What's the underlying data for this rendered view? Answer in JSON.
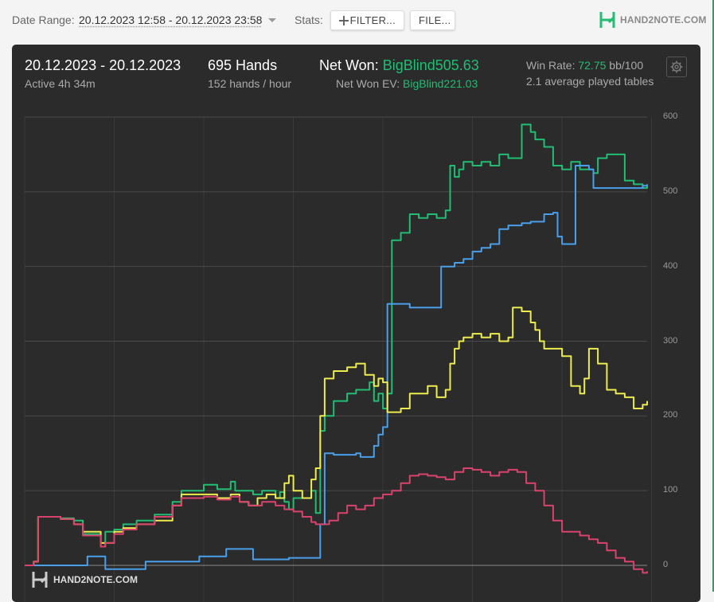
{
  "topbar": {
    "date_range_label": "Date Range:",
    "date_range_value": "20.12.2023 12:58 - 20.12.2023 23:58",
    "stats_label": "Stats:",
    "filter_button": "FILTER...",
    "file_button": "FILE...",
    "brand": "HAND2NOTE.COM"
  },
  "summary": {
    "dates": "20.12.2023 - 20.12.2023",
    "active": "Active 4h 34m",
    "hands": "695 Hands",
    "hands_per_hour": "152 hands / hour",
    "net_won_label": "Net Won:",
    "net_won_value": "BigBlind505.63",
    "net_won_ev_label": "Net Won  EV:",
    "net_won_ev_value": "BigBlind221.03",
    "win_rate_label": "Win Rate:",
    "win_rate_value": "72.75",
    "win_rate_unit": "bb/100",
    "avg_tables": "2.1 average played tables"
  },
  "watermark": "HAND2NOTE.COM",
  "colors": {
    "green": "#21bd73",
    "blue": "#4a9fea",
    "yellow": "#ecec4e",
    "red": "#d9426c",
    "panel": "#2b2b2b"
  },
  "icons": [
    "gear-icon",
    "plus-icon",
    "hand2note-logo-icon"
  ],
  "chart_data": {
    "type": "line",
    "title": "",
    "xlabel": "",
    "ylabel": "",
    "xlim": [
      0,
      695
    ],
    "ylim": [
      0,
      600
    ],
    "yticks": [
      0,
      100,
      200,
      300,
      400,
      500,
      600
    ],
    "grid": true,
    "legend": "none",
    "series": [
      {
        "color": "#21bd73",
        "points": [
          [
            0,
            0
          ],
          [
            10,
            5
          ],
          [
            15,
            65
          ],
          [
            40,
            63
          ],
          [
            55,
            60
          ],
          [
            65,
            42
          ],
          [
            85,
            25
          ],
          [
            90,
            45
          ],
          [
            100,
            48
          ],
          [
            110,
            55
          ],
          [
            125,
            60
          ],
          [
            145,
            68
          ],
          [
            165,
            85
          ],
          [
            175,
            100
          ],
          [
            200,
            108
          ],
          [
            215,
            102
          ],
          [
            230,
            112
          ],
          [
            235,
            100
          ],
          [
            255,
            95
          ],
          [
            265,
            100
          ],
          [
            280,
            90
          ],
          [
            285,
            98
          ],
          [
            290,
            85
          ],
          [
            295,
            75
          ],
          [
            300,
            90
          ],
          [
            320,
            100
          ],
          [
            325,
            70
          ],
          [
            330,
            180
          ],
          [
            335,
            200
          ],
          [
            345,
            220
          ],
          [
            360,
            230
          ],
          [
            370,
            235
          ],
          [
            385,
            245
          ],
          [
            390,
            220
          ],
          [
            395,
            230
          ],
          [
            400,
            210
          ],
          [
            405,
            230
          ],
          [
            410,
            435
          ],
          [
            420,
            445
          ],
          [
            430,
            470
          ],
          [
            440,
            465
          ],
          [
            450,
            470
          ],
          [
            460,
            465
          ],
          [
            470,
            475
          ],
          [
            475,
            535
          ],
          [
            480,
            520
          ],
          [
            485,
            530
          ],
          [
            490,
            540
          ],
          [
            500,
            535
          ],
          [
            510,
            540
          ],
          [
            520,
            535
          ],
          [
            530,
            550
          ],
          [
            540,
            545
          ],
          [
            550,
            545
          ],
          [
            555,
            590
          ],
          [
            565,
            580
          ],
          [
            570,
            570
          ],
          [
            580,
            560
          ],
          [
            590,
            535
          ],
          [
            600,
            530
          ],
          [
            610,
            540
          ],
          [
            620,
            530
          ],
          [
            635,
            525
          ],
          [
            640,
            545
          ],
          [
            650,
            550
          ],
          [
            660,
            550
          ],
          [
            670,
            515
          ],
          [
            680,
            510
          ],
          [
            690,
            505
          ],
          [
            695,
            508
          ]
        ]
      },
      {
        "color": "#4a9fea",
        "points": [
          [
            0,
            0
          ],
          [
            65,
            0
          ],
          [
            70,
            12
          ],
          [
            85,
            12
          ],
          [
            90,
            -5
          ],
          [
            130,
            -5
          ],
          [
            135,
            5
          ],
          [
            190,
            5
          ],
          [
            195,
            12
          ],
          [
            220,
            12
          ],
          [
            225,
            22
          ],
          [
            250,
            22
          ],
          [
            255,
            8
          ],
          [
            290,
            8
          ],
          [
            295,
            10
          ],
          [
            320,
            10
          ],
          [
            330,
            55
          ],
          [
            335,
            150
          ],
          [
            345,
            148
          ],
          [
            370,
            150
          ],
          [
            375,
            145
          ],
          [
            385,
            145
          ],
          [
            390,
            160
          ],
          [
            395,
            175
          ],
          [
            400,
            185
          ],
          [
            405,
            350
          ],
          [
            420,
            350
          ],
          [
            430,
            345
          ],
          [
            445,
            345
          ],
          [
            450,
            345
          ],
          [
            460,
            345
          ],
          [
            465,
            400
          ],
          [
            480,
            405
          ],
          [
            490,
            410
          ],
          [
            500,
            420
          ],
          [
            510,
            425
          ],
          [
            520,
            430
          ],
          [
            530,
            450
          ],
          [
            540,
            455
          ],
          [
            555,
            458
          ],
          [
            565,
            460
          ],
          [
            575,
            460
          ],
          [
            580,
            470
          ],
          [
            590,
            472
          ],
          [
            595,
            440
          ],
          [
            600,
            430
          ],
          [
            610,
            430
          ],
          [
            615,
            535
          ],
          [
            625,
            535
          ],
          [
            630,
            530
          ],
          [
            635,
            505
          ],
          [
            660,
            505
          ],
          [
            680,
            505
          ],
          [
            690,
            508
          ],
          [
            695,
            510
          ]
        ]
      },
      {
        "color": "#ecec4e",
        "points": [
          [
            0,
            0
          ],
          [
            10,
            5
          ],
          [
            15,
            65
          ],
          [
            40,
            62
          ],
          [
            55,
            55
          ],
          [
            65,
            45
          ],
          [
            85,
            30
          ],
          [
            90,
            30
          ],
          [
            100,
            45
          ],
          [
            110,
            50
          ],
          [
            125,
            55
          ],
          [
            145,
            60
          ],
          [
            165,
            80
          ],
          [
            175,
            95
          ],
          [
            200,
            95
          ],
          [
            215,
            90
          ],
          [
            230,
            95
          ],
          [
            240,
            85
          ],
          [
            250,
            80
          ],
          [
            260,
            90
          ],
          [
            270,
            95
          ],
          [
            280,
            90
          ],
          [
            290,
            110
          ],
          [
            295,
            120
          ],
          [
            300,
            100
          ],
          [
            310,
            90
          ],
          [
            320,
            115
          ],
          [
            325,
            130
          ],
          [
            330,
            200
          ],
          [
            335,
            250
          ],
          [
            345,
            260
          ],
          [
            360,
            265
          ],
          [
            370,
            270
          ],
          [
            380,
            255
          ],
          [
            390,
            240
          ],
          [
            395,
            250
          ],
          [
            400,
            245
          ],
          [
            405,
            205
          ],
          [
            420,
            210
          ],
          [
            430,
            230
          ],
          [
            440,
            230
          ],
          [
            450,
            240
          ],
          [
            460,
            225
          ],
          [
            470,
            235
          ],
          [
            475,
            270
          ],
          [
            480,
            290
          ],
          [
            485,
            300
          ],
          [
            490,
            305
          ],
          [
            500,
            310
          ],
          [
            510,
            305
          ],
          [
            520,
            310
          ],
          [
            530,
            300
          ],
          [
            540,
            305
          ],
          [
            545,
            345
          ],
          [
            555,
            340
          ],
          [
            565,
            325
          ],
          [
            570,
            315
          ],
          [
            575,
            300
          ],
          [
            580,
            290
          ],
          [
            590,
            290
          ],
          [
            600,
            280
          ],
          [
            610,
            240
          ],
          [
            620,
            230
          ],
          [
            625,
            250
          ],
          [
            630,
            290
          ],
          [
            640,
            270
          ],
          [
            650,
            235
          ],
          [
            660,
            230
          ],
          [
            670,
            225
          ],
          [
            680,
            210
          ],
          [
            690,
            215
          ],
          [
            695,
            220
          ]
        ]
      },
      {
        "color": "#d9426c",
        "points": [
          [
            0,
            0
          ],
          [
            10,
            5
          ],
          [
            15,
            65
          ],
          [
            40,
            62
          ],
          [
            55,
            55
          ],
          [
            65,
            40
          ],
          [
            85,
            25
          ],
          [
            90,
            30
          ],
          [
            100,
            42
          ],
          [
            110,
            48
          ],
          [
            125,
            55
          ],
          [
            145,
            65
          ],
          [
            165,
            80
          ],
          [
            175,
            90
          ],
          [
            200,
            92
          ],
          [
            215,
            88
          ],
          [
            230,
            92
          ],
          [
            240,
            85
          ],
          [
            250,
            80
          ],
          [
            265,
            85
          ],
          [
            280,
            80
          ],
          [
            290,
            75
          ],
          [
            300,
            72
          ],
          [
            310,
            65
          ],
          [
            320,
            58
          ],
          [
            325,
            55
          ],
          [
            340,
            60
          ],
          [
            350,
            70
          ],
          [
            360,
            80
          ],
          [
            370,
            75
          ],
          [
            380,
            80
          ],
          [
            390,
            90
          ],
          [
            400,
            95
          ],
          [
            410,
            100
          ],
          [
            420,
            110
          ],
          [
            430,
            120
          ],
          [
            440,
            122
          ],
          [
            450,
            120
          ],
          [
            460,
            118
          ],
          [
            470,
            115
          ],
          [
            480,
            125
          ],
          [
            490,
            130
          ],
          [
            500,
            128
          ],
          [
            510,
            125
          ],
          [
            520,
            120
          ],
          [
            530,
            125
          ],
          [
            540,
            128
          ],
          [
            550,
            125
          ],
          [
            560,
            110
          ],
          [
            570,
            100
          ],
          [
            580,
            80
          ],
          [
            590,
            60
          ],
          [
            600,
            45
          ],
          [
            620,
            40
          ],
          [
            630,
            35
          ],
          [
            640,
            30
          ],
          [
            650,
            20
          ],
          [
            660,
            10
          ],
          [
            670,
            5
          ],
          [
            680,
            -5
          ],
          [
            690,
            -10
          ],
          [
            695,
            -8
          ]
        ]
      }
    ]
  }
}
